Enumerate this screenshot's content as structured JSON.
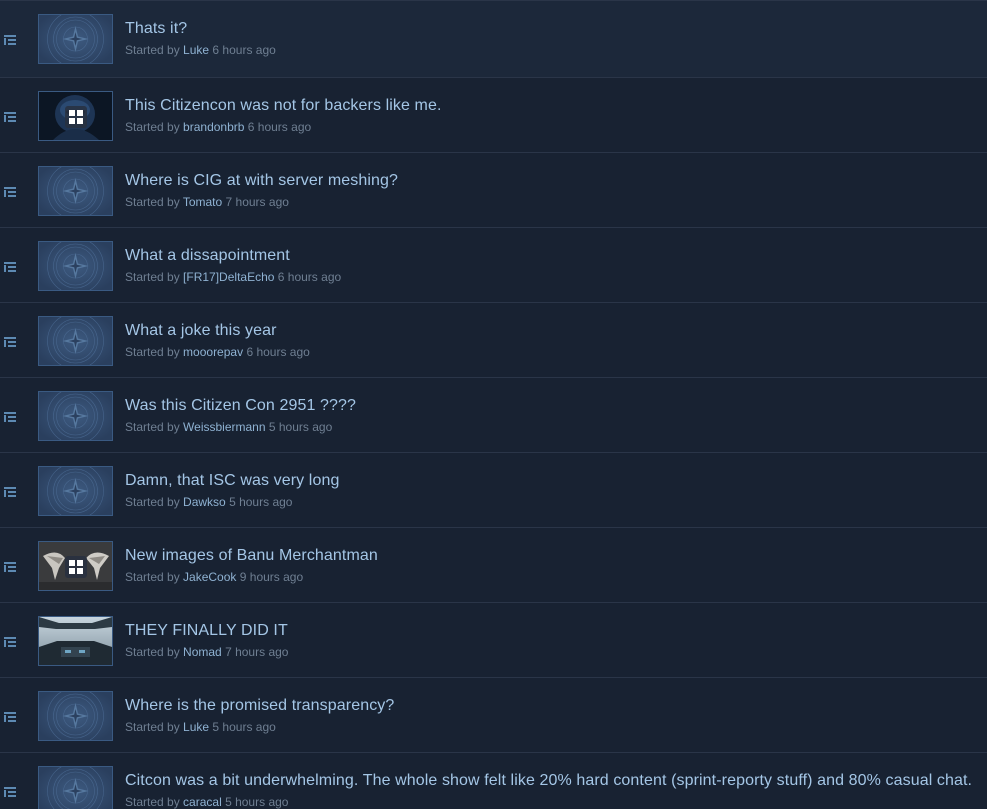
{
  "forum": {
    "meta_prefix": "Started by",
    "threads": [
      {
        "title": "Thats it?",
        "author": "Luke",
        "time": "6 hours ago",
        "thumb": "emblem"
      },
      {
        "title": "This Citizencon was not for backers like me.",
        "author": "brandonbrb",
        "time": "6 hours ago",
        "thumb": "portrait"
      },
      {
        "title": "Where is CIG at with server meshing?",
        "author": "Tomato",
        "time": "7 hours ago",
        "thumb": "emblem"
      },
      {
        "title": "What a dissapointment",
        "author": "[FR17]DeltaEcho",
        "time": "6 hours ago",
        "thumb": "emblem"
      },
      {
        "title": "What a joke this year",
        "author": "mooorepav",
        "time": "6 hours ago",
        "thumb": "emblem"
      },
      {
        "title": "Was this Citizen Con 2951 ????",
        "author": "Weissbiermann",
        "time": "5 hours ago",
        "thumb": "emblem"
      },
      {
        "title": "Damn, that ISC was very long",
        "author": "Dawkso",
        "time": "5 hours ago",
        "thumb": "emblem"
      },
      {
        "title": "New images of Banu Merchantman",
        "author": "JakeCook",
        "time": "9 hours ago",
        "thumb": "ships"
      },
      {
        "title": "THEY FINALLY DID IT",
        "author": "Nomad",
        "time": "7 hours ago",
        "thumb": "cockpit"
      },
      {
        "title": "Where is the promised transparency?",
        "author": "Luke",
        "time": "5 hours ago",
        "thumb": "emblem"
      },
      {
        "title": "Citcon was a bit underwhelming. The whole show felt like 20% hard content (sprint-reporty stuff) and 80% casual chat.",
        "author": "caracal",
        "time": "5 hours ago",
        "thumb": "emblem"
      }
    ]
  },
  "colors": {
    "background": "#17202e",
    "title": "#a4c6e6",
    "author": "#8fb2d2",
    "meta": "#6f7f92",
    "divider": "#2a3548"
  },
  "icons": {
    "thread_type": "discussion-list-icon",
    "gallery_overlay": "image-gallery-icon"
  }
}
